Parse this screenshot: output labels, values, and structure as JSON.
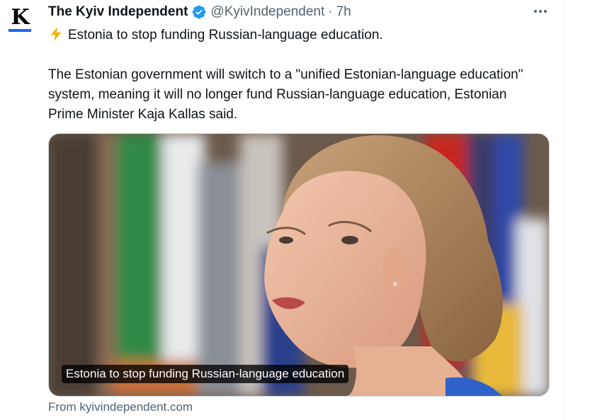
{
  "author": {
    "avatar_letter": "K",
    "display_name": "The Kyiv Independent",
    "handle": "@KyivIndependent",
    "separator": "·",
    "time": "7h"
  },
  "icons": {
    "verified": "verified-badge-icon",
    "lightning": "lightning-emoji-icon",
    "more": "more-options-icon"
  },
  "tweet": {
    "headline": "Estonia to stop funding Russian-language education.",
    "body": "The Estonian government will switch to a \"unified Estonian-language education\" system, meaning it will no longer fund Russian-language education, Estonian Prime Minister Kaja Kallas said."
  },
  "card": {
    "title": "Estonia to stop funding Russian-language education",
    "source": "From kyivindependent.com"
  },
  "colors": {
    "verified": "#1d9bf0",
    "secondary_text": "#536471",
    "logo_underline": "#1d63f0"
  }
}
